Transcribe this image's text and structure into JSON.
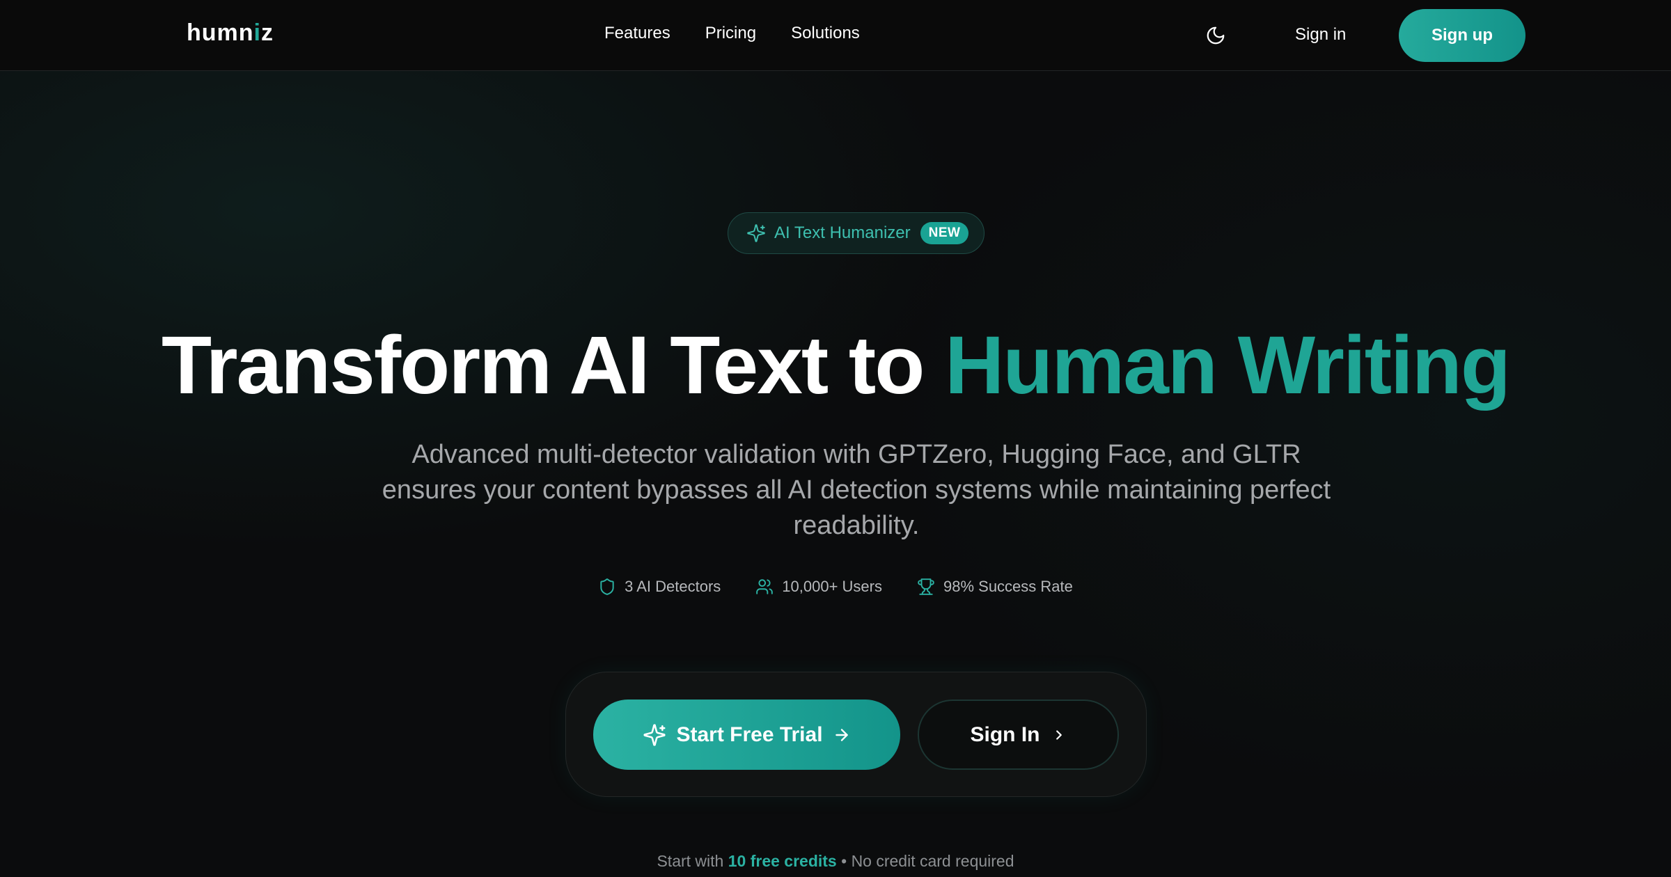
{
  "nav": {
    "logo_prefix": "humn",
    "logo_accent": "i",
    "logo_suffix": "z",
    "links": [
      "Features",
      "Pricing",
      "Solutions"
    ],
    "theme_icon": "moon-icon",
    "sign_in": "Sign in",
    "sign_up": "Sign up"
  },
  "badge": {
    "icon": "sparkles-icon",
    "label": "AI Text Humanizer",
    "tag": "NEW"
  },
  "hero": {
    "title_plain": "Transform AI Text to",
    "title_highlight": "Human Writing",
    "subtitle": "Advanced multi-detector validation with GPTZero, Hugging Face, and GLTR ensures your content bypasses all AI detection systems while maintaining perfect readability."
  },
  "stats": [
    {
      "icon": "shield-icon",
      "label": "3 AI Detectors"
    },
    {
      "icon": "users-icon",
      "label": "10,000+ Users"
    },
    {
      "icon": "trophy-icon",
      "label": "98% Success Rate"
    }
  ],
  "cta": {
    "primary": "Start Free Trial",
    "secondary": "Sign In"
  },
  "footnote": {
    "prefix": "Start with",
    "credits": "10 free credits",
    "separator": "•",
    "suffix": "No credit card required"
  },
  "colors": {
    "accent": "#1fa595",
    "background": "#0b0c0d",
    "text_muted": "#a6a8ab"
  }
}
